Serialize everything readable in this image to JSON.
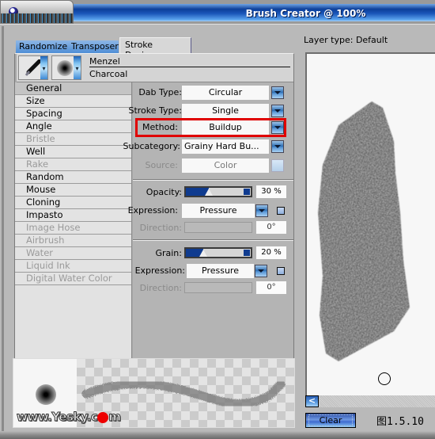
{
  "window": {
    "title": "Brush Creator @ 100%"
  },
  "tabs": [
    {
      "label": "Randomizer",
      "active": false
    },
    {
      "label": "Transposer",
      "active": false
    },
    {
      "label": "Stroke Designer",
      "active": true
    }
  ],
  "variant": {
    "category": "Menzel",
    "name": "Charcoal",
    "category_icon": "pencil-icon",
    "dab_icon": "dab-preview-icon"
  },
  "categories": [
    {
      "label": "General",
      "selected": true,
      "enabled": true
    },
    {
      "label": "Size",
      "selected": false,
      "enabled": true
    },
    {
      "label": "Spacing",
      "selected": false,
      "enabled": true
    },
    {
      "label": "Angle",
      "selected": false,
      "enabled": true
    },
    {
      "label": "Bristle",
      "selected": false,
      "enabled": false
    },
    {
      "label": "Well",
      "selected": false,
      "enabled": true
    },
    {
      "label": "Rake",
      "selected": false,
      "enabled": false
    },
    {
      "label": "Random",
      "selected": false,
      "enabled": true
    },
    {
      "label": "Mouse",
      "selected": false,
      "enabled": true
    },
    {
      "label": "Cloning",
      "selected": false,
      "enabled": true
    },
    {
      "label": "Impasto",
      "selected": false,
      "enabled": true
    },
    {
      "label": "Image Hose",
      "selected": false,
      "enabled": false
    },
    {
      "label": "Airbrush",
      "selected": false,
      "enabled": false
    },
    {
      "label": "Water",
      "selected": false,
      "enabled": false
    },
    {
      "label": "Liquid Ink",
      "selected": false,
      "enabled": false
    },
    {
      "label": "Digital Water Color",
      "selected": false,
      "enabled": false
    }
  ],
  "general": {
    "dab_type": {
      "label": "Dab Type:",
      "value": "Circular"
    },
    "stroke_type": {
      "label": "Stroke Type:",
      "value": "Single"
    },
    "method": {
      "label": "Method:",
      "value": "Buildup",
      "highlighted": true
    },
    "subcategory": {
      "label": "Subcategory:",
      "value": "Grainy Hard Bu..."
    },
    "source": {
      "label": "Source:",
      "value": "Color",
      "enabled": false
    }
  },
  "opacity": {
    "label": "Opacity:",
    "value_text": "30 %",
    "value_percent": 30,
    "expression": {
      "label": "Expression:",
      "value": "Pressure"
    },
    "direction": {
      "label": "Direction:",
      "value_text": "0°",
      "enabled": false
    }
  },
  "grain": {
    "label": "Grain:",
    "value_text": "20 %",
    "value_percent": 20,
    "expression": {
      "label": "Expression:",
      "value": "Pressure"
    },
    "direction": {
      "label": "Direction:",
      "value_text": "0°",
      "enabled": false
    }
  },
  "preview": {
    "watermark": "www.Yesky.c",
    "watermark_tail": "m"
  },
  "right": {
    "layer_type": "Layer type: Default",
    "clear_label": "Clear",
    "scroll_left_glyph": "<",
    "figure_label": "图1.5.10"
  },
  "colors": {
    "titlebar_blue": "#0c3f9a",
    "highlight_red": "#e00000",
    "slider_fill": "#0f3b8f"
  }
}
